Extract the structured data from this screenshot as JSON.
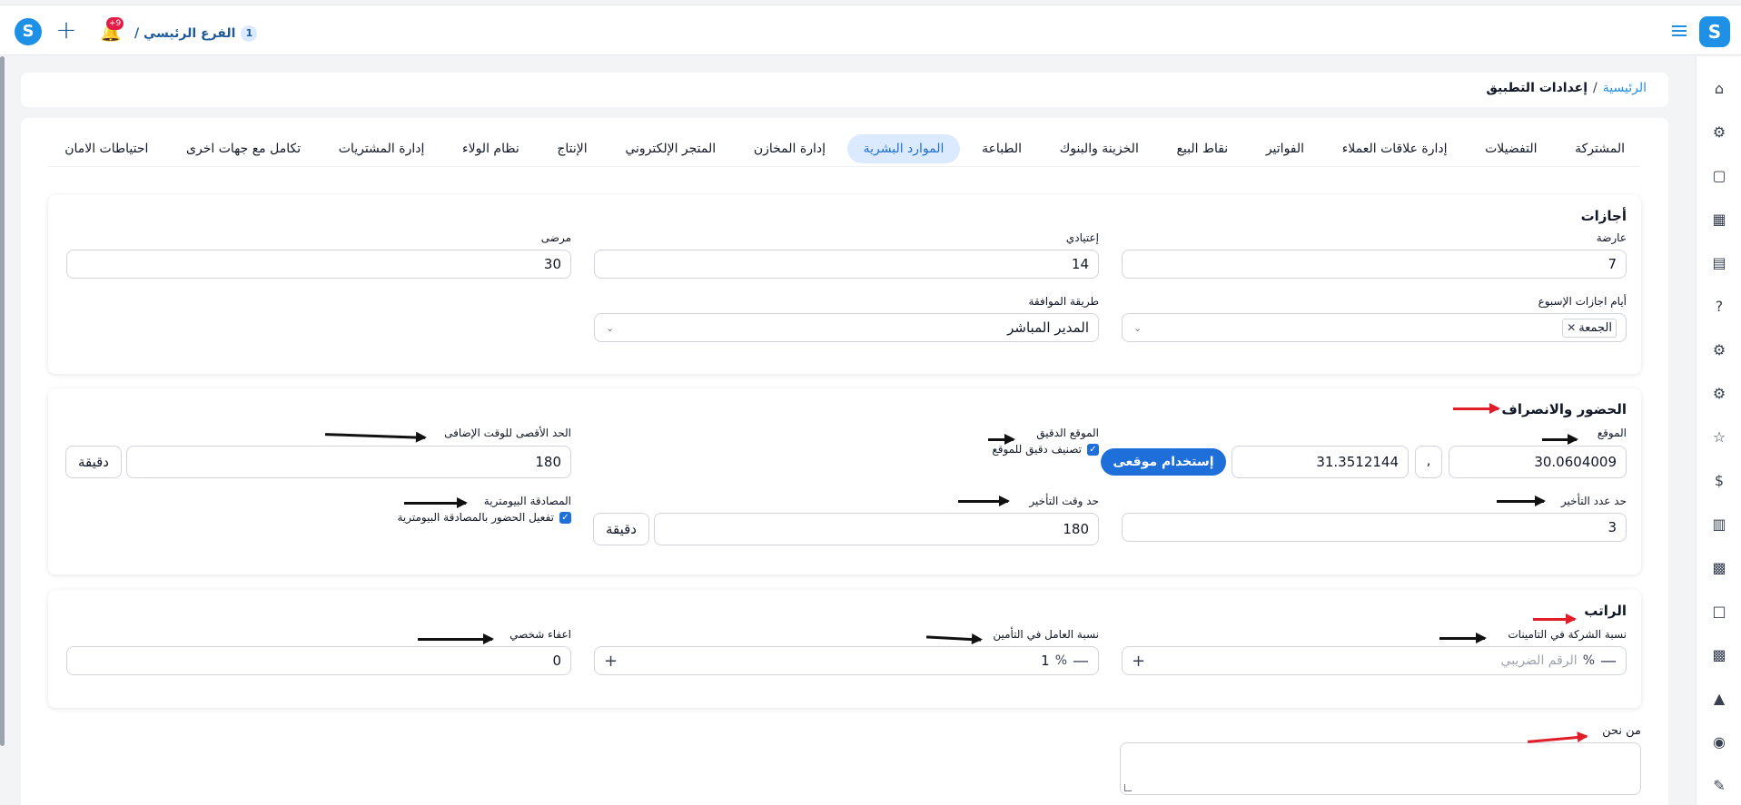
{
  "topbar": {
    "logo": "S",
    "branch_name": "الفرع الرئيسي /",
    "branch_count": "1",
    "notifications_badge": "+9",
    "plus_icon": "plus-icon",
    "bell_icon": "bell-icon",
    "menu_icon": "hamburger-icon"
  },
  "breadcrumb": {
    "home": "الرئيسية",
    "separator": "/",
    "current": "إعدادات التطبيق"
  },
  "tabs": [
    {
      "label": "المشتركة",
      "active": false
    },
    {
      "label": "التفضيلات",
      "active": false
    },
    {
      "label": "إدارة علاقات العملاء",
      "active": false
    },
    {
      "label": "الفواتير",
      "active": false
    },
    {
      "label": "نقاط البيع",
      "active": false
    },
    {
      "label": "الخزينة والبنوك",
      "active": false
    },
    {
      "label": "الطباعة",
      "active": false
    },
    {
      "label": "الموارد البشرية",
      "active": true
    },
    {
      "label": "إدارة المخازن",
      "active": false
    },
    {
      "label": "المتجر الإلكتروني",
      "active": false
    },
    {
      "label": "الإنتاج",
      "active": false
    },
    {
      "label": "نظام الولاء",
      "active": false
    },
    {
      "label": "إدارة المشتريات",
      "active": false
    },
    {
      "label": "تكامل مع جهات اخرى",
      "active": false
    },
    {
      "label": "احتياطات الامان",
      "active": false
    }
  ],
  "leaves": {
    "title": "أجازات",
    "casual_label": "عارضة",
    "casual_value": "7",
    "regular_label": "إعتيادي",
    "regular_value": "14",
    "sick_label": "مرضى",
    "sick_value": "30",
    "weekend_label": "أيام اجازات الإسبوع",
    "weekend_chip": "الجمعة",
    "approval_label": "طريقة الموافقة",
    "approval_value": "المدير المباشر"
  },
  "attendance": {
    "title": "الحضور والانصراف",
    "location_label": "الموقع",
    "latitude": "30.0604009",
    "comma": ",",
    "longitude": "31.3512144",
    "use_location_btn": "إستخدام موقعى",
    "precise_label": "الموقع الدقيق",
    "precise_check": "تصنيف دقيق للموقع",
    "overtime_label": "الحد الأقصى للوقت الإضافى",
    "overtime_value": "180",
    "overtime_unit": "دقيقة",
    "late_count_label": "حد عدد التأخير",
    "late_count_value": "3",
    "late_time_label": "حد وقت التأخير",
    "late_time_value": "180",
    "late_time_unit": "دقيقة",
    "biometric_label": "المصادقة البيومترية",
    "biometric_check": "تفعيل الحضور بالمصادقة البيومترية"
  },
  "salary": {
    "title": "الراتب",
    "company_ins_label": "نسبة الشركة في التامينات",
    "company_ins_placeholder": "الرقم الضريبي",
    "worker_ins_label": "نسبة العامل في التأمين",
    "worker_ins_value": "1",
    "personal_exempt_label": "اعفاء شخصي",
    "personal_exempt_value": "0",
    "percent": "%",
    "minus": "—",
    "plus": "+"
  },
  "about": {
    "label": "من نحن"
  },
  "sidebar_icons": [
    "home-icon",
    "users-gear-icon",
    "book-icon",
    "building-icon",
    "receipt-icon",
    "help-icon",
    "users-gear-icon",
    "users-gear-icon",
    "star-card-icon",
    "cash-icon",
    "warehouse-icon",
    "id-card-icon",
    "document-icon",
    "id-card-icon",
    "fuel-icon",
    "robot-icon",
    "pen-icon"
  ],
  "colors": {
    "accent": "#1e6fd9",
    "active_tab_bg": "#dbeafe",
    "arrow_red": "#e11d2a",
    "arrow_black": "#111111"
  }
}
